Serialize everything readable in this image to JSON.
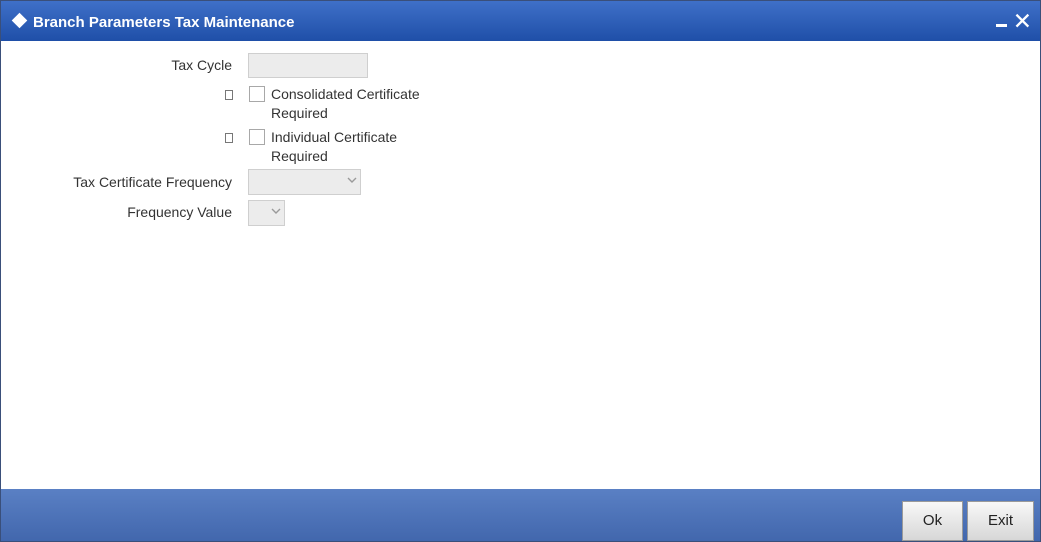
{
  "window": {
    "title": "Branch Parameters Tax Maintenance",
    "minimize_icon": "minimize-icon",
    "close_label": "✕"
  },
  "form": {
    "tax_cycle": {
      "label": "Tax Cycle",
      "value": ""
    },
    "consolidated_certificate": {
      "label_line1": "Consolidated Certificate",
      "label_line2": "Required",
      "checked": false
    },
    "individual_certificate": {
      "label_line1": "Individual Certificate",
      "label_line2": "Required",
      "checked": false
    },
    "tax_certificate_frequency": {
      "label": "Tax Certificate Frequency",
      "value": ""
    },
    "frequency_value": {
      "label": "Frequency Value",
      "value": ""
    }
  },
  "footer": {
    "ok_label": "Ok",
    "exit_label": "Exit"
  },
  "colors": {
    "titlebar": "#2a5bb5",
    "footer": "#4b70b5"
  }
}
